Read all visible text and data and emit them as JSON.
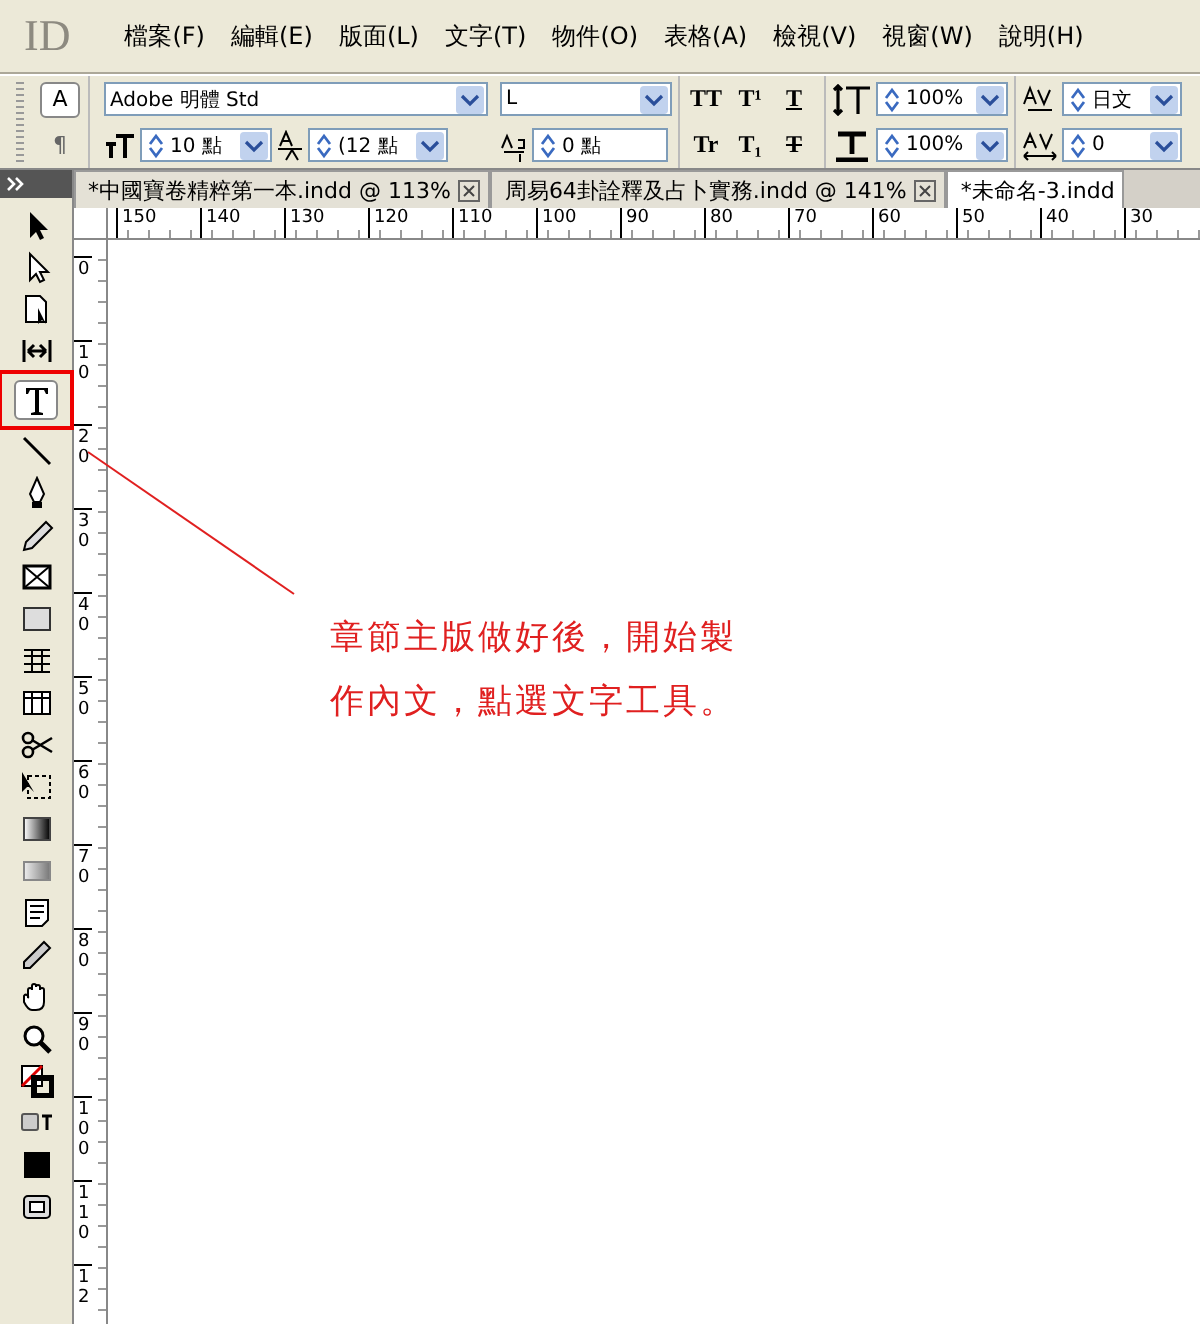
{
  "logo": "ID",
  "menu": [
    "檔案(F)",
    "編輯(E)",
    "版面(L)",
    "文字(T)",
    "物件(O)",
    "表格(A)",
    "檢視(V)",
    "視窗(W)",
    "說明(H)"
  ],
  "control_panel": {
    "mode_buttons": [
      {
        "label": "A",
        "selected": true
      },
      {
        "label": "¶",
        "selected": false
      }
    ],
    "font_family": "Adobe 明體 Std",
    "font_style": "L",
    "font_size": "10 點",
    "leading": "(12 點",
    "baseline_shift": "0 點",
    "style_buttons": [
      {
        "label": "TT",
        "kind": "caps"
      },
      {
        "label": "T¹",
        "kind": "plain"
      },
      {
        "label": "T",
        "kind": "underline"
      },
      {
        "label": "Tr",
        "kind": "plain"
      },
      {
        "label": "T₁",
        "kind": "plain"
      },
      {
        "label": "T",
        "kind": "strike"
      }
    ],
    "vertical_scale": "100%",
    "horizontal_scale": "100%",
    "kerning": "日文",
    "tracking": "0"
  },
  "tabs": [
    {
      "label": "*中國寶卷精粹第一本.indd @ 113%",
      "selected": false,
      "closable": true
    },
    {
      "label": "周易64卦詮釋及占卜實務.indd @ 141%",
      "selected": false,
      "closable": true
    },
    {
      "label": "*未命名-3.indd",
      "selected": true,
      "closable": false
    }
  ],
  "ruler": {
    "horizontal": [
      "150",
      "140",
      "130",
      "120",
      "110",
      "100",
      "90",
      "80",
      "70",
      "60",
      "50",
      "40",
      "30"
    ],
    "vertical": [
      "0",
      "10",
      "20",
      "30",
      "40",
      "50",
      "60",
      "70",
      "80",
      "90",
      "100",
      "110",
      "12"
    ]
  },
  "tools": [
    {
      "kind": "selection",
      "selected": false
    },
    {
      "kind": "direct",
      "selected": false
    },
    {
      "kind": "page",
      "selected": false
    },
    {
      "kind": "gap",
      "selected": false
    },
    {
      "kind": "type",
      "selected": true,
      "highlighted": true
    },
    {
      "kind": "line",
      "selected": false
    },
    {
      "kind": "pen",
      "selected": false
    },
    {
      "kind": "pencil",
      "selected": false
    },
    {
      "kind": "frame",
      "selected": false
    },
    {
      "kind": "rectangle",
      "selected": false
    },
    {
      "kind": "table",
      "selected": false
    },
    {
      "kind": "columns",
      "selected": false
    },
    {
      "kind": "scissors",
      "selected": false
    },
    {
      "kind": "transform",
      "selected": false
    },
    {
      "kind": "gradient",
      "selected": false
    },
    {
      "kind": "feather",
      "selected": false
    },
    {
      "kind": "note",
      "selected": false
    },
    {
      "kind": "eyedropper",
      "selected": false
    },
    {
      "kind": "hand",
      "selected": false
    },
    {
      "kind": "zoom",
      "selected": false
    },
    {
      "kind": "fillstroke",
      "selected": false
    },
    {
      "kind": "formatting",
      "selected": false
    },
    {
      "kind": "normal",
      "selected": false
    },
    {
      "kind": "preview",
      "selected": false
    }
  ],
  "annotation": {
    "text": "章節主版做好後，開始製作內文，點選文字工具。"
  }
}
